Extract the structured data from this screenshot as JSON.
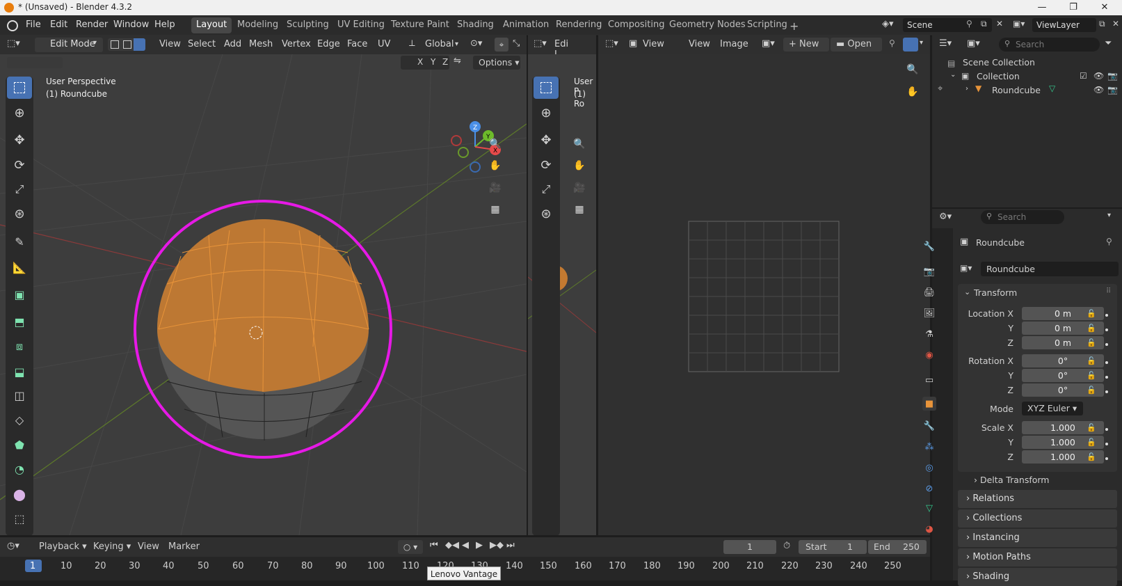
{
  "window": {
    "title": "* (Unsaved) - Blender 4.3.2"
  },
  "menus": [
    "File",
    "Edit",
    "Render",
    "Window",
    "Help"
  ],
  "workspaces": [
    "Layout",
    "Modeling",
    "Sculpting",
    "UV Editing",
    "Texture Paint",
    "Shading",
    "Animation",
    "Rendering",
    "Compositing",
    "Geometry Nodes",
    "Scripting"
  ],
  "active_workspace": "Layout",
  "scene": {
    "name": "Scene",
    "view_layer": "ViewLayer"
  },
  "viewport": {
    "mode": "Edit Mode",
    "menu": [
      "View",
      "Select",
      "Add",
      "Mesh",
      "Vertex",
      "Edge",
      "Face",
      "UV"
    ],
    "orientation": "Global",
    "axes": [
      "X",
      "Y",
      "Z"
    ],
    "options_label": "Options",
    "perspective_label": "User Perspective",
    "object_label": "(1) Roundcube",
    "gizmo": {
      "x": "X",
      "y": "Y",
      "z": "Z"
    }
  },
  "viewport2": {
    "mode_short": "Edit I",
    "perspective_short": "User P",
    "object_short": "(1) Ro"
  },
  "image_editor": {
    "menu": [
      "View",
      "View",
      "Image"
    ],
    "new_label": "New",
    "open_label": "Open"
  },
  "outliner": {
    "search_placeholder": "Search",
    "scene_collection": "Scene Collection",
    "collection": "Collection",
    "object": "Roundcube"
  },
  "properties": {
    "search_placeholder": "Search",
    "object_name": "Roundcube",
    "data_name": "Roundcube",
    "transform_label": "Transform",
    "location_x_label": "Location X",
    "location_x": "0 m",
    "location_y_label": "Y",
    "location_y": "0 m",
    "location_z_label": "Z",
    "location_z": "0 m",
    "rotation_x_label": "Rotation X",
    "rotation_x": "0°",
    "rotation_y_label": "Y",
    "rotation_y": "0°",
    "rotation_z_label": "Z",
    "rotation_z": "0°",
    "mode_label": "Mode",
    "mode_value": "XYZ Euler",
    "scale_x_label": "Scale X",
    "scale_x": "1.000",
    "scale_y_label": "Y",
    "scale_y": "1.000",
    "scale_z_label": "Z",
    "scale_z": "1.000",
    "delta_transform": "Delta Transform",
    "sections": [
      "Relations",
      "Collections",
      "Instancing",
      "Motion Paths",
      "Shading"
    ]
  },
  "timeline": {
    "menu": [
      "Playback",
      "Keying",
      "View",
      "Marker"
    ],
    "current_frame": "1",
    "start_label": "Start",
    "start": "1",
    "end_label": "End",
    "end": "250",
    "ruler": [
      "1",
      "10",
      "20",
      "30",
      "40",
      "50",
      "60",
      "70",
      "80",
      "90",
      "100",
      "110",
      "120",
      "130",
      "140",
      "150",
      "160",
      "170",
      "180",
      "190",
      "200",
      "210",
      "220",
      "230",
      "240",
      "250"
    ]
  },
  "tooltip": "Lenovo Vantage",
  "colors": {
    "accent": "#4772b3",
    "selection": "#ff9a2e",
    "highlight_circle": "#e619e6"
  }
}
